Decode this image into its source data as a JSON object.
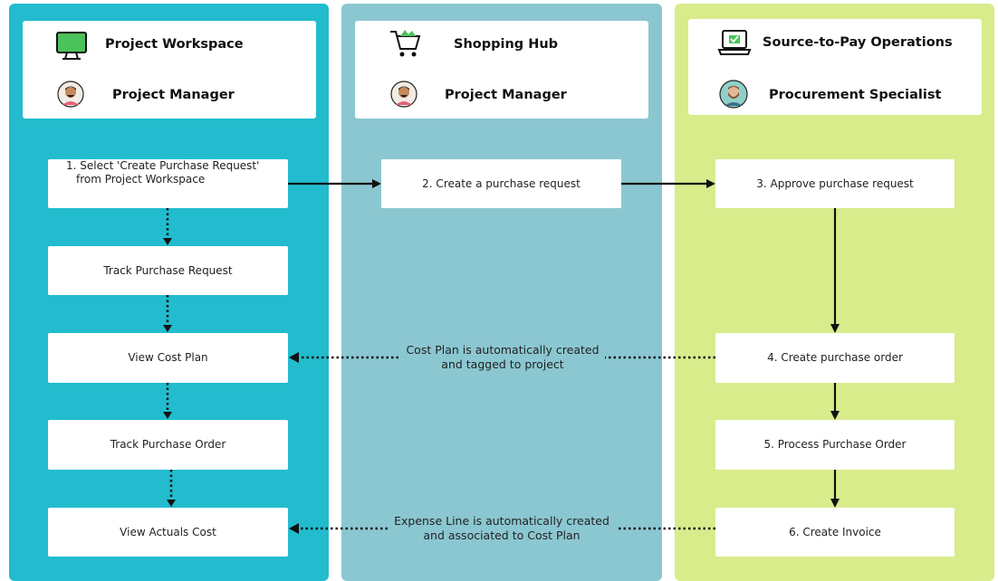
{
  "lanes": [
    {
      "system": "Project Workspace",
      "role": "Project Manager"
    },
    {
      "system": "Shopping Hub",
      "role": "Project Manager"
    },
    {
      "system": "Source-to-Pay Operations",
      "role": "Procurement Specialist"
    }
  ],
  "steps": {
    "select_create_line1": "1. Select 'Create Purchase Request'",
    "select_create_line2": "from Project Workspace",
    "track_purchase_request": "Track Purchase Request",
    "view_cost_plan": "View Cost Plan",
    "track_purchase_order": "Track Purchase Order",
    "view_actuals_cost": "View Actuals Cost",
    "create_purchase_request": "2. Create a purchase request",
    "approve_purchase_request": "3. Approve purchase request",
    "create_purchase_order": "4. Create purchase order",
    "process_purchase_order": "5. Process Purchase Order",
    "create_invoice": "6. Create Invoice"
  },
  "notes": {
    "cost_plan_line1": "Cost Plan is automatically created",
    "cost_plan_line2": "and tagged to project",
    "expense_line1": "Expense Line is automatically created",
    "expense_line2": "and associated to Cost Plan"
  },
  "icons": {
    "lane1_system": "monitor-icon",
    "lane2_system": "shopping-cart-icon",
    "lane3_system": "laptop-check-icon",
    "lane1_role": "person-avatar-icon",
    "lane2_role": "person-avatar-icon",
    "lane3_role": "bearded-person-avatar-icon"
  },
  "colors": {
    "lane1": "#22bcce",
    "lane2": "#8bc7d1",
    "lane3": "#d8ec8c",
    "accent_green": "#4cc25a"
  }
}
